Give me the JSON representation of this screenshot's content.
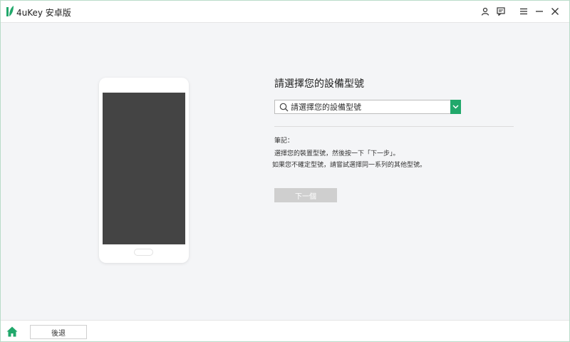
{
  "app": {
    "title": "4uKey 安卓版",
    "accent_color": "#21a86b"
  },
  "titlebar": {
    "icons": [
      "user-icon",
      "feedback-icon",
      "menu-icon",
      "minimize-icon",
      "close-icon"
    ]
  },
  "main": {
    "heading": "請選擇您的設備型號",
    "model_select": {
      "placeholder": "請選擇您的設備型號",
      "value": ""
    },
    "notes": {
      "label": "筆記：",
      "line1": "選擇您的裝置型號，然後按一下「下一步」。",
      "line2": "如果您不確定型號，請嘗試選擇同一系列的其他型號。"
    },
    "next_button": "下一個"
  },
  "bottombar": {
    "back_button": "後退"
  }
}
